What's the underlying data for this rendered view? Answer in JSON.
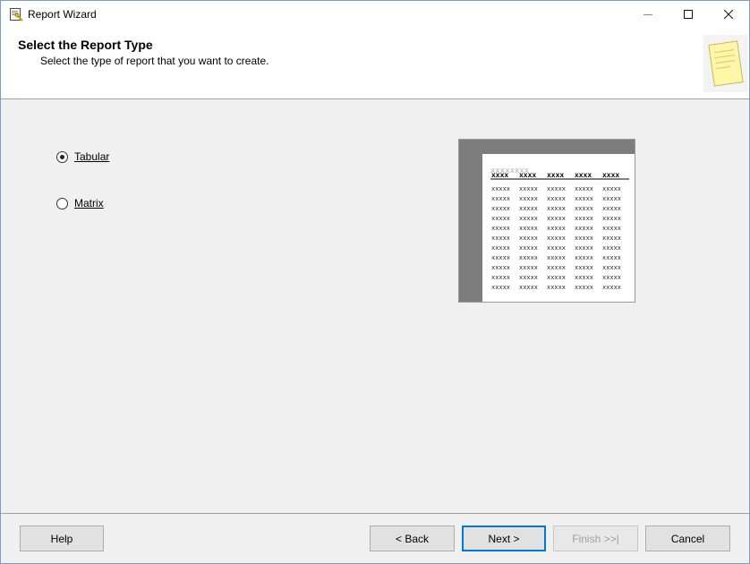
{
  "window": {
    "title": "Report Wizard",
    "controls": {
      "minimize": "minimize-icon",
      "maximize": "maximize-icon",
      "close": "close-icon"
    }
  },
  "header": {
    "title": "Select the Report Type",
    "subtitle": "Select the type of report that you want to create."
  },
  "report_types": [
    {
      "label": "Tabular",
      "selected": true
    },
    {
      "label": "Matrix",
      "selected": false
    }
  ],
  "preview": {
    "title_text": "xxxxxxxx",
    "header_cells": [
      "xxxx",
      "xxxx",
      "xxxx",
      "xxxx",
      "xxxx"
    ],
    "cell_text": "xxxxx",
    "row_count": 11
  },
  "buttons": {
    "help": "Help",
    "back": "< Back",
    "next": "Next >",
    "finish": "Finish >>|",
    "cancel": "Cancel"
  },
  "colors": {
    "accent": "#0078d7",
    "preview_background": "#7d7d7d",
    "disabled_text": "#a0a0a0"
  }
}
